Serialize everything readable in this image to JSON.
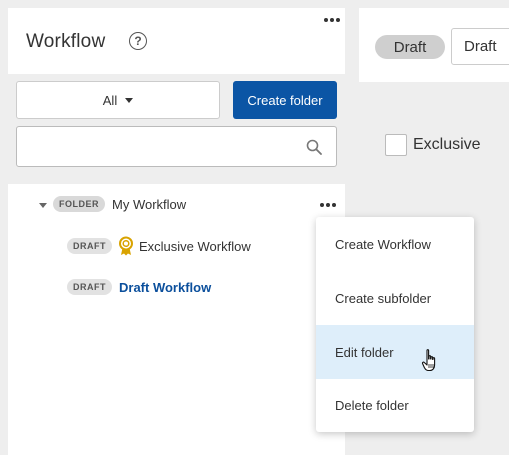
{
  "panel": {
    "title": "Workflow",
    "help_icon": "question-circle-icon",
    "help_glyph": "?",
    "more_icon": "more-horizontal-icon"
  },
  "filter": {
    "selected": "All",
    "create_folder_label": "Create folder",
    "search_placeholder": "",
    "search_icon": "search-icon"
  },
  "tree": {
    "folder": {
      "badge": "FOLDER",
      "label": "My Workflow",
      "expanded": true
    },
    "items": [
      {
        "badge": "DRAFT",
        "icon": "award-icon",
        "label": "Exclusive Workflow"
      },
      {
        "badge": "DRAFT",
        "label": "Draft Workflow"
      }
    ]
  },
  "context_menu": {
    "items": [
      {
        "label": "Create Workflow"
      },
      {
        "label": "Create subfolder"
      },
      {
        "label": "Edit folder",
        "hovered": true
      },
      {
        "label": "Delete folder"
      }
    ]
  },
  "detail": {
    "status_pill": "Draft",
    "status_select": "Draft",
    "exclusive_label": "Exclusive",
    "exclusive_checked": false
  },
  "colors": {
    "primary": "#0b55a5",
    "link": "#0b4f9c",
    "hover_bg": "#deeefa",
    "background": "#eeeeee"
  }
}
